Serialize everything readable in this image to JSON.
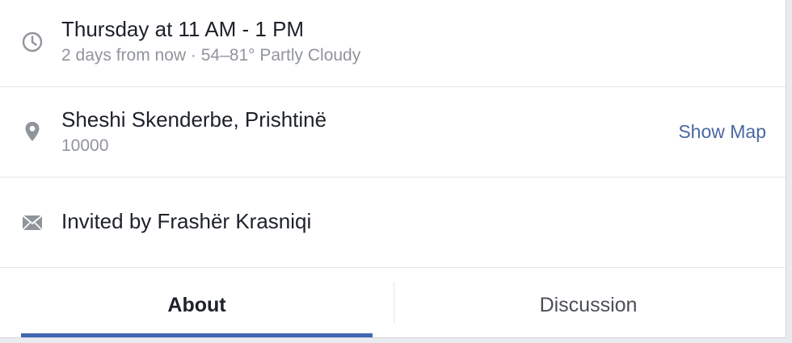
{
  "event_details": {
    "time": {
      "icon": "clock-icon",
      "primary": "Thursday at 11 AM - 1 PM",
      "secondary": "2 days from now · 54–81° Partly Cloudy"
    },
    "location": {
      "icon": "map-pin-icon",
      "primary": "Sheshi Skenderbe, Prishtinë",
      "secondary": "10000",
      "action_label": "Show Map"
    },
    "invite": {
      "icon": "envelope-icon",
      "primary": "Invited by Frashër Krasniqi"
    }
  },
  "tabs": [
    {
      "label": "About",
      "active": true
    },
    {
      "label": "Discussion",
      "active": false
    }
  ],
  "colors": {
    "accent": "#4267b2",
    "link": "#4b67a1",
    "text": "#1d2129",
    "muted": "#90949c",
    "icon": "#90949c"
  }
}
